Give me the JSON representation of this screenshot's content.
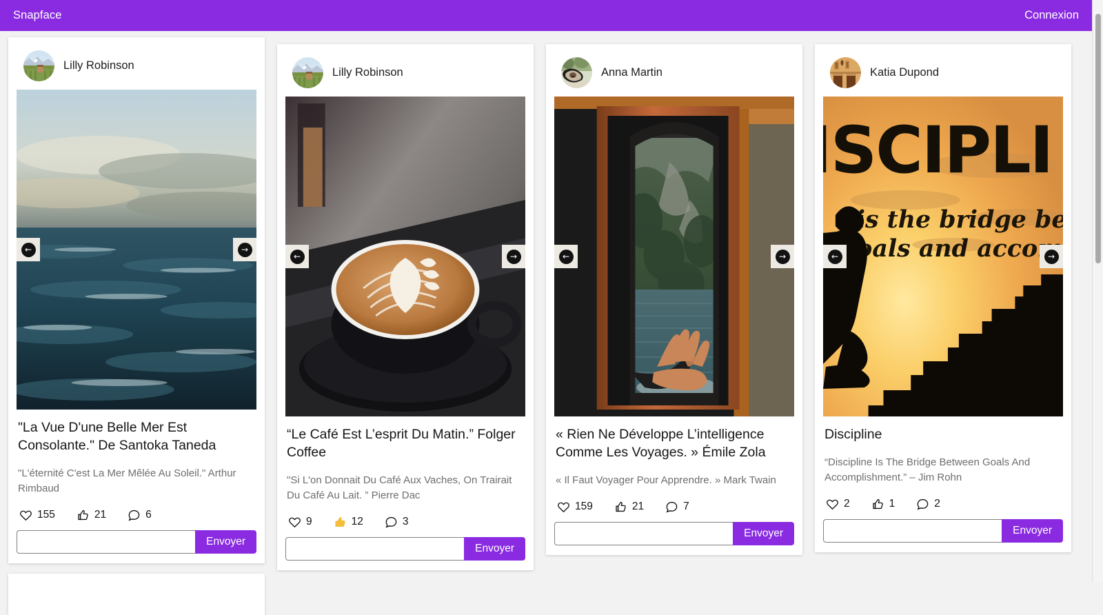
{
  "header": {
    "brand": "Snapface",
    "login_label": "Connexion",
    "background_color": "#8A2BE2",
    "text_color": "#FFFFFF"
  },
  "carousel": {
    "prev_label": "←",
    "next_label": "→",
    "prev_icon": "arrow-left-icon",
    "next_icon": "arrow-right-icon"
  },
  "form": {
    "send_label": "Envoyer",
    "input_value": "",
    "input_placeholder": ""
  },
  "theme": {
    "accent": "#8A2BE2",
    "liked_thumb": "#F2BE3C",
    "page_background": "#F2F2F2",
    "card_background": "#FFFFFF"
  },
  "posts": [
    {
      "author": "Lilly Robinson",
      "avatar_name": "avatar-vineyard-mountain",
      "image_name": "post-image-sea-ocean",
      "title": "\"La Vue D'une Belle Mer Est Consolante.\" De Santoka Taneda",
      "description": "\"L'éternité C'est La Mer Mêlée Au Soleil.\" Arthur Rimbaud",
      "hearts": "155",
      "thumbs": "21",
      "comments": "6",
      "thumb_liked": false
    },
    {
      "author": "Lilly Robinson",
      "avatar_name": "avatar-vineyard-mountain",
      "image_name": "post-image-latte-coffee",
      "title": "“Le Café Est L’esprit Du Matin.” Folger Coffee",
      "description": "\"Si L'on Donnait Du Café Aux Vaches, On Trairait Du Café Au Lait. ” Pierre Dac",
      "hearts": "9",
      "thumbs": "12",
      "comments": "3",
      "thumb_liked": true
    },
    {
      "author": "Anna Martin",
      "avatar_name": "avatar-car-mirror",
      "image_name": "post-image-fjord-window",
      "title": "« Rien Ne Développe L’intelligence Comme Les Voyages. » Émile Zola",
      "description": "« Il Faut Voyager Pour Apprendre. » Mark Twain",
      "hearts": "159",
      "thumbs": "21",
      "comments": "7",
      "thumb_liked": false
    },
    {
      "author": "Katia Dupond",
      "avatar_name": "avatar-building-facade",
      "image_name": "post-image-discipline-stairs",
      "title": "Discipline",
      "description": "“Discipline Is The Bridge Between Goals And Accomplishment.” – Jim Rohn",
      "hearts": "2",
      "thumbs": "1",
      "comments": "2",
      "thumb_liked": false
    }
  ]
}
